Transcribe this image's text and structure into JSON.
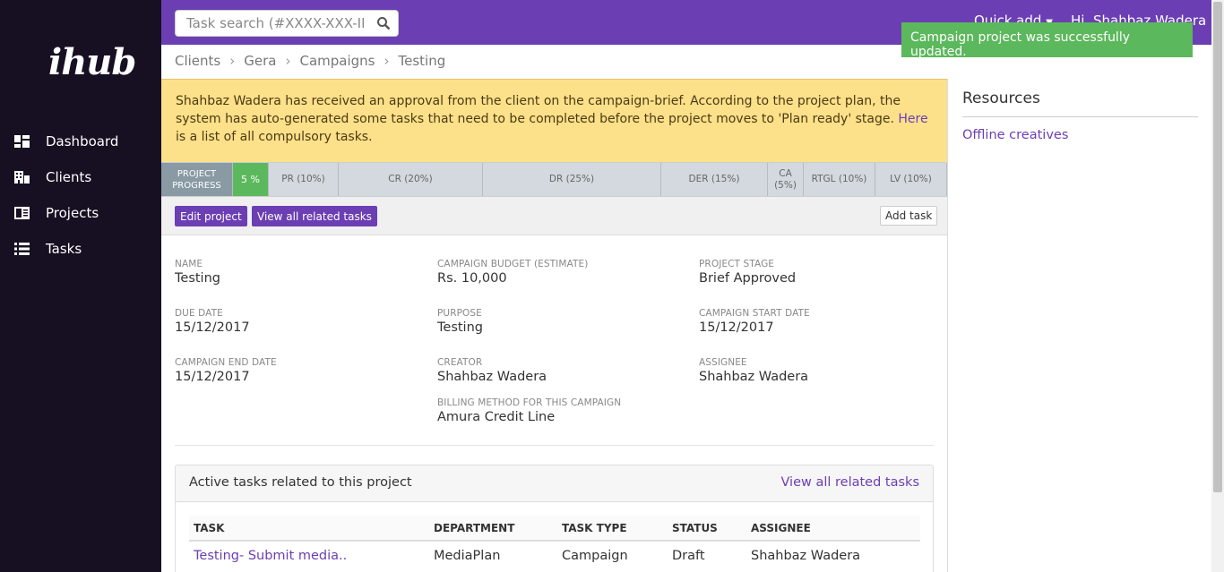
{
  "app": {
    "logo": "ihub"
  },
  "sidebar": {
    "items": [
      {
        "label": "Dashboard",
        "icon": "dashboard-icon"
      },
      {
        "label": "Clients",
        "icon": "building-icon"
      },
      {
        "label": "Projects",
        "icon": "projects-icon"
      },
      {
        "label": "Tasks",
        "icon": "list-icon"
      }
    ]
  },
  "topbar": {
    "search_placeholder": "Task search (#XXXX-XXX-ID)",
    "quick_add": "Quick add",
    "user_greeting": "Hi, Shahbaz Wadera"
  },
  "toast": {
    "message": "Campaign project was successfully updated."
  },
  "breadcrumb": [
    "Clients",
    "Gera",
    "Campaigns",
    "Testing"
  ],
  "alert": {
    "text_before": "Shahbaz Wadera has received an approval from the client on the campaign-brief. According to the project plan, the system has auto-generated some tasks that need to be completed before the project moves to 'Plan ready' stage.",
    "link": "Here",
    "text_after": "is a list of all compulsory tasks."
  },
  "progress": {
    "label_line1": "PROJECT",
    "label_line2": "PROGRESS",
    "done": "5 %",
    "stages": [
      "PR (10%)",
      "CR (20%)",
      "DR (25%)",
      "DER (15%)",
      "CA (5%)",
      "RTGL (10%)",
      "LV (10%)"
    ]
  },
  "actions": {
    "edit_project": "Edit project",
    "view_related": "View all related tasks",
    "add_task": "Add task"
  },
  "details": {
    "name_label": "NAME",
    "name": "Testing",
    "budget_label": "CAMPAIGN BUDGET (ESTIMATE)",
    "budget": "Rs. 10,000",
    "stage_label": "PROJECT STAGE",
    "stage": "Brief Approved",
    "due_label": "DUE DATE",
    "due": "15/12/2017",
    "purpose_label": "PURPOSE",
    "purpose": "Testing",
    "start_label": "CAMPAIGN START DATE",
    "start": "15/12/2017",
    "end_label": "CAMPAIGN END DATE",
    "end": "15/12/2017",
    "creator_label": "CREATOR",
    "creator": "Shahbaz Wadera",
    "assignee_label": "ASSIGNEE",
    "assignee": "Shahbaz Wadera",
    "billing_label": "BILLING METHOD FOR THIS CAMPAIGN",
    "billing": "Amura Credit Line"
  },
  "tasks_panel": {
    "title": "Active tasks related to this project",
    "view_all": "View all related tasks",
    "columns": [
      "TASK",
      "DEPARTMENT",
      "TASK TYPE",
      "STATUS",
      "ASSIGNEE"
    ],
    "rows": [
      {
        "task": "Testing- Submit media..",
        "department": "MediaPlan",
        "type": "Campaign",
        "status": "Draft",
        "assignee": "Shahbaz Wadera"
      }
    ]
  },
  "resources": {
    "title": "Resources",
    "link": "Offline creatives"
  },
  "colors": {
    "brand": "#6b3fb3",
    "sidebar": "#170f22",
    "success": "#5cb85c",
    "alert": "#fde08a"
  }
}
